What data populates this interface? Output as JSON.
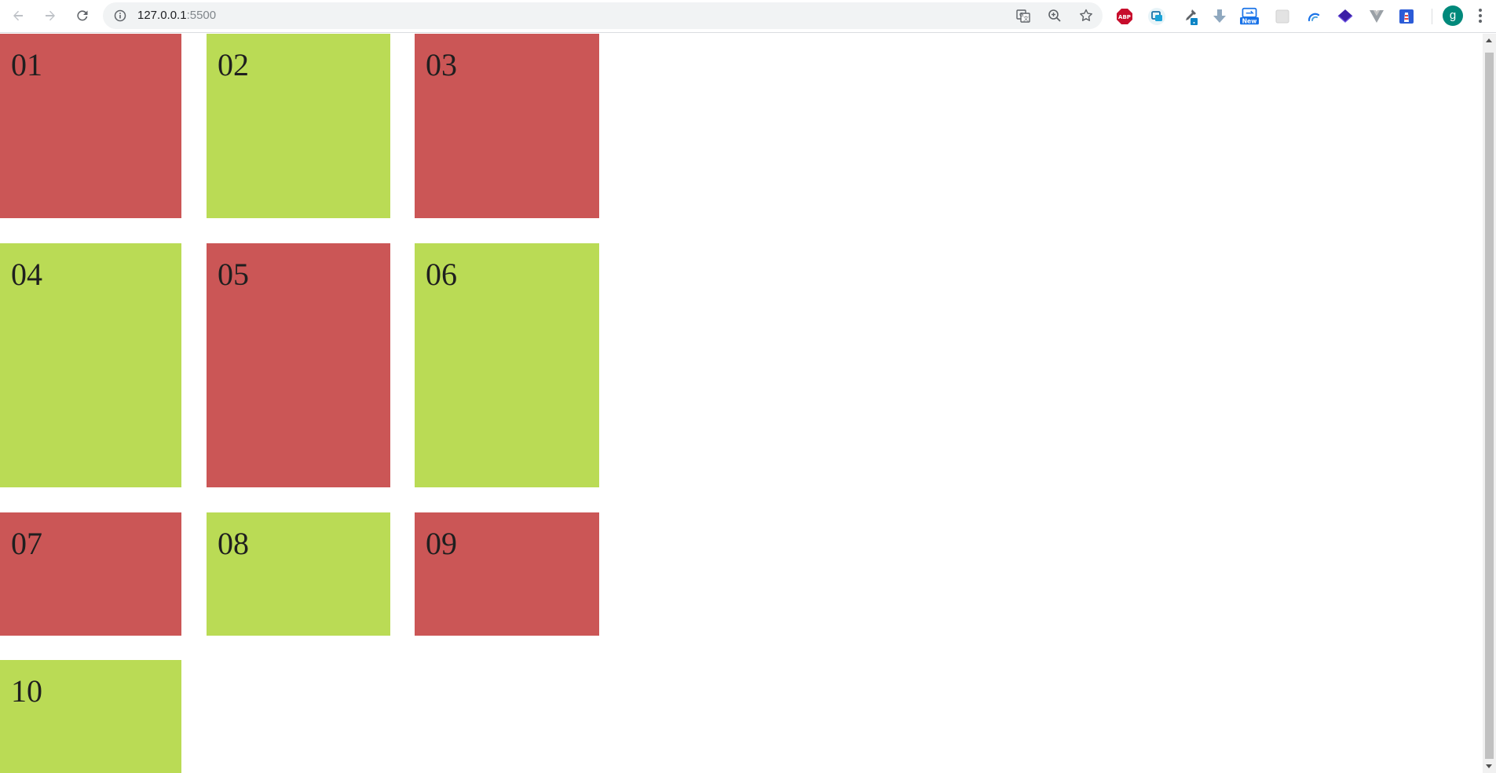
{
  "browser": {
    "url_host": "127.0.0.1",
    "url_port": ":5500",
    "profile_initial": "g",
    "icons": {
      "back": "arrow-left-icon",
      "forward": "arrow-right-icon",
      "reload": "reload-icon",
      "site_info": "info-icon",
      "translate": "translate-icon",
      "zoom": "zoom-icon",
      "bookmark": "star-icon"
    },
    "extensions": [
      {
        "name": "adblock-plus-icon",
        "label": "ABP"
      },
      {
        "name": "screencast-icon",
        "label": ""
      },
      {
        "name": "eyedropper-icon",
        "label": ""
      },
      {
        "name": "download-icon",
        "label": ""
      },
      {
        "name": "screenshot-new-icon",
        "label": "New"
      },
      {
        "name": "grey-square-icon",
        "label": ""
      },
      {
        "name": "edge-swirl-icon",
        "label": ""
      },
      {
        "name": "layers-icon",
        "label": ""
      },
      {
        "name": "vue-icon",
        "label": ""
      },
      {
        "name": "lighthouse-icon",
        "label": ""
      }
    ]
  },
  "colors": {
    "red": "#cb5656",
    "green": "#badb55",
    "text": "#1f1f1f"
  },
  "cells": [
    {
      "label": "01",
      "color": "red"
    },
    {
      "label": "02",
      "color": "green"
    },
    {
      "label": "03",
      "color": "red"
    },
    {
      "label": "04",
      "color": "green"
    },
    {
      "label": "05",
      "color": "red"
    },
    {
      "label": "06",
      "color": "green"
    },
    {
      "label": "07",
      "color": "red"
    },
    {
      "label": "08",
      "color": "green"
    },
    {
      "label": "09",
      "color": "red"
    },
    {
      "label": "10",
      "color": "green"
    }
  ]
}
